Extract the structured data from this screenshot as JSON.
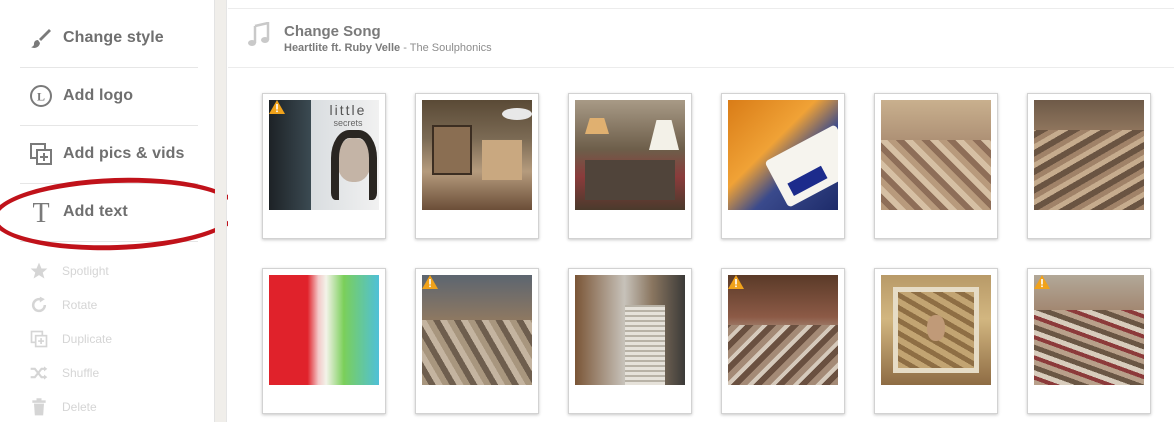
{
  "sidebar": {
    "items": [
      {
        "label": "Change style",
        "icon": "brush-icon"
      },
      {
        "label": "Add logo",
        "icon": "logo-circle-icon"
      },
      {
        "label": "Add pics & vids",
        "icon": "add-pics-icon"
      },
      {
        "label": "Add text",
        "icon": "text-t-icon"
      }
    ],
    "sub_items": [
      {
        "label": "Spotlight",
        "icon": "star-icon"
      },
      {
        "label": "Rotate",
        "icon": "rotate-icon"
      },
      {
        "label": "Duplicate",
        "icon": "duplicate-icon"
      },
      {
        "label": "Shuffle",
        "icon": "shuffle-icon"
      },
      {
        "label": "Delete",
        "icon": "trash-icon"
      }
    ]
  },
  "song": {
    "title": "Change Song",
    "track": "Heartlite ft. Ruby Velle",
    "separator": " - ",
    "artist": "The Soulphonics",
    "icon": "music-note-icon"
  },
  "album_cover": {
    "title": "little",
    "subtitle": "secrets"
  },
  "tiles": [
    {
      "warning": true
    },
    {
      "warning": false
    },
    {
      "warning": false
    },
    {
      "warning": false
    },
    {
      "warning": false
    },
    {
      "warning": false
    },
    {
      "warning": false
    },
    {
      "warning": true
    },
    {
      "warning": false
    },
    {
      "warning": true
    },
    {
      "warning": false
    },
    {
      "warning": true
    }
  ],
  "colors": {
    "highlight": "#c0121a",
    "warning": "#f0a21b",
    "label_gray": "#6f6f6f",
    "disabled_gray": "#d5d5d5"
  }
}
